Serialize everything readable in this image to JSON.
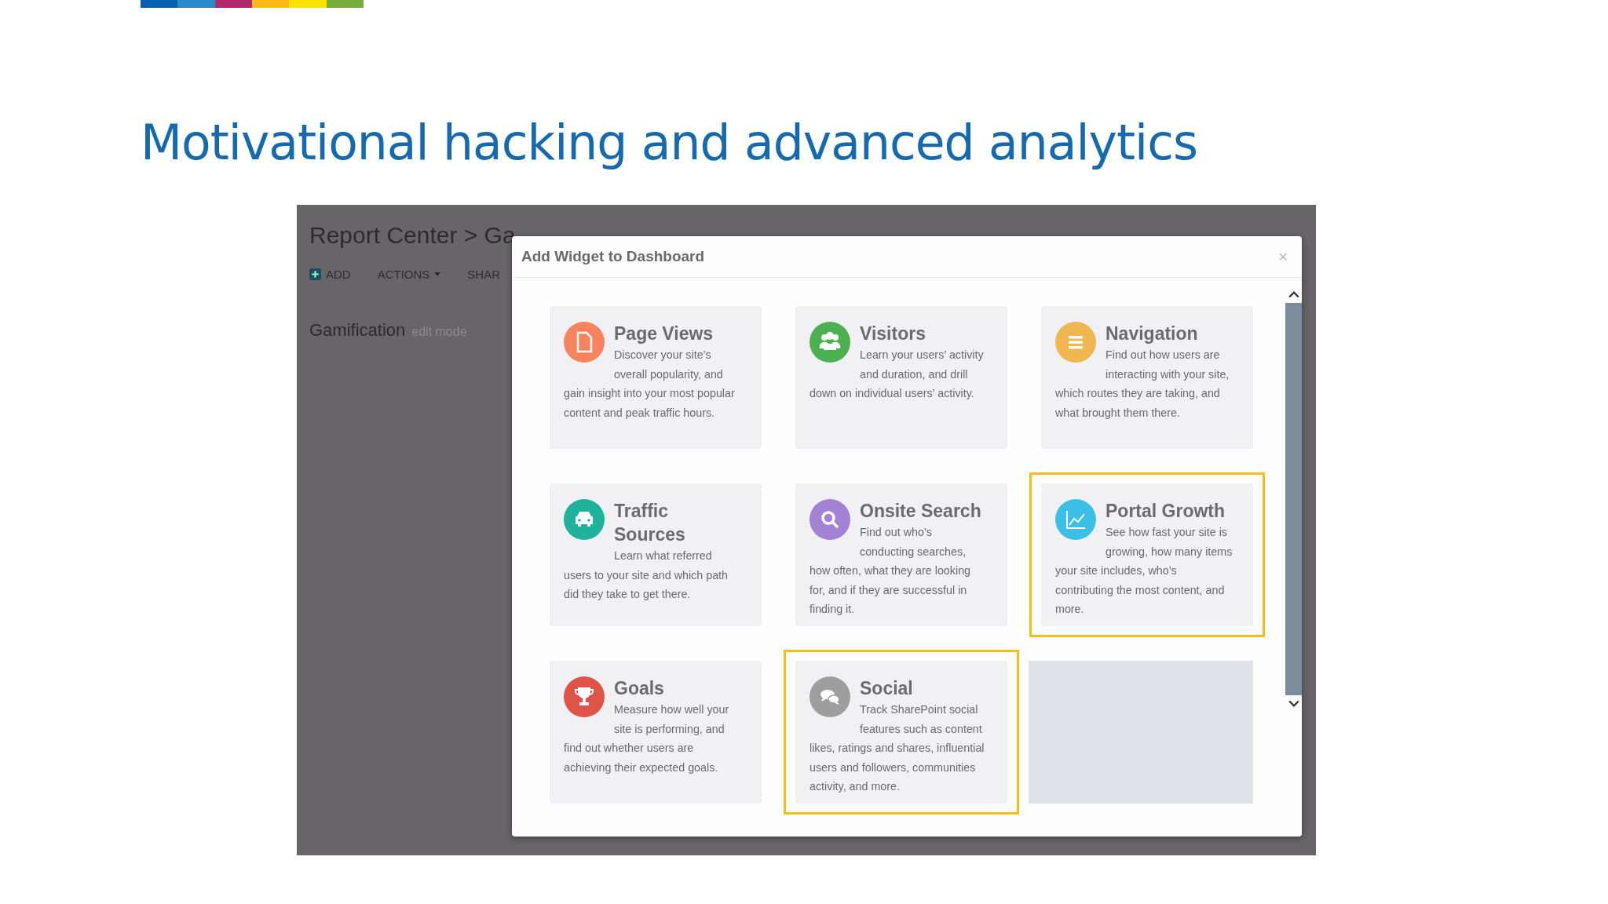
{
  "slide": {
    "title": "Motivational hacking and advanced analytics"
  },
  "stripe": [
    {
      "color": "#0563ad"
    },
    {
      "color": "#2a8ac8"
    },
    {
      "color": "#b0286e"
    },
    {
      "color": "#fdbb13"
    },
    {
      "color": "#fde200"
    },
    {
      "color": "#7aae3c"
    }
  ],
  "background_page": {
    "breadcrumb": "Report Center > Ga",
    "toolbar": [
      {
        "label": "ADD",
        "kind": "add"
      },
      {
        "label": "ACTIONS",
        "kind": "dropdown"
      },
      {
        "label": "SHAR",
        "kind": "plain"
      }
    ],
    "heading": "Gamification",
    "heading_note": "edit mode"
  },
  "dialog": {
    "title": "Add Widget to Dashboard",
    "close": "×",
    "widgets": [
      {
        "kind": "widget",
        "title": "Page Views",
        "description": "Discover your site’s overall popularity, and gain insight into your most popular content and peak traffic hours.",
        "color": "#f7845e",
        "highlighted": false
      },
      {
        "kind": "widget",
        "title": "Visitors",
        "description": "Learn your users’ activity and duration, and drill down on individual users’ activity.",
        "color": "#4cb050",
        "highlighted": false
      },
      {
        "kind": "widget",
        "title": "Navigation",
        "description": "Find out how users are interacting with your site, which routes they are taking, and what brought them there.",
        "color": "#f0b64f",
        "highlighted": false
      },
      {
        "kind": "widget",
        "title": "Traffic Sources",
        "description": "Learn what referred users to your site and which path did they take to get there.",
        "color": "#1fb29c",
        "highlighted": false
      },
      {
        "kind": "widget",
        "title": "Onsite Search",
        "description": "Find out who’s conducting searches, how often, what they are looking for, and if they are successful in finding it.",
        "color": "#a382d6",
        "highlighted": false
      },
      {
        "kind": "widget",
        "title": "Portal Growth",
        "description": "See how fast your site is growing, how many items your site includes, who’s contributing the most content, and more.",
        "color": "#3cbfe6",
        "highlighted": true
      },
      {
        "kind": "widget",
        "title": "Goals",
        "description": "Measure how well your site is performing, and find out whether users are achieving their expected goals.",
        "color": "#df5348",
        "highlighted": false
      },
      {
        "kind": "widget",
        "title": "Social",
        "description": "Track SharePoint social features such as content likes, ratings and shares, influential users and followers, communities activity, and more.",
        "color": "#9e9e9e",
        "highlighted": true
      },
      {
        "kind": "empty"
      }
    ]
  }
}
